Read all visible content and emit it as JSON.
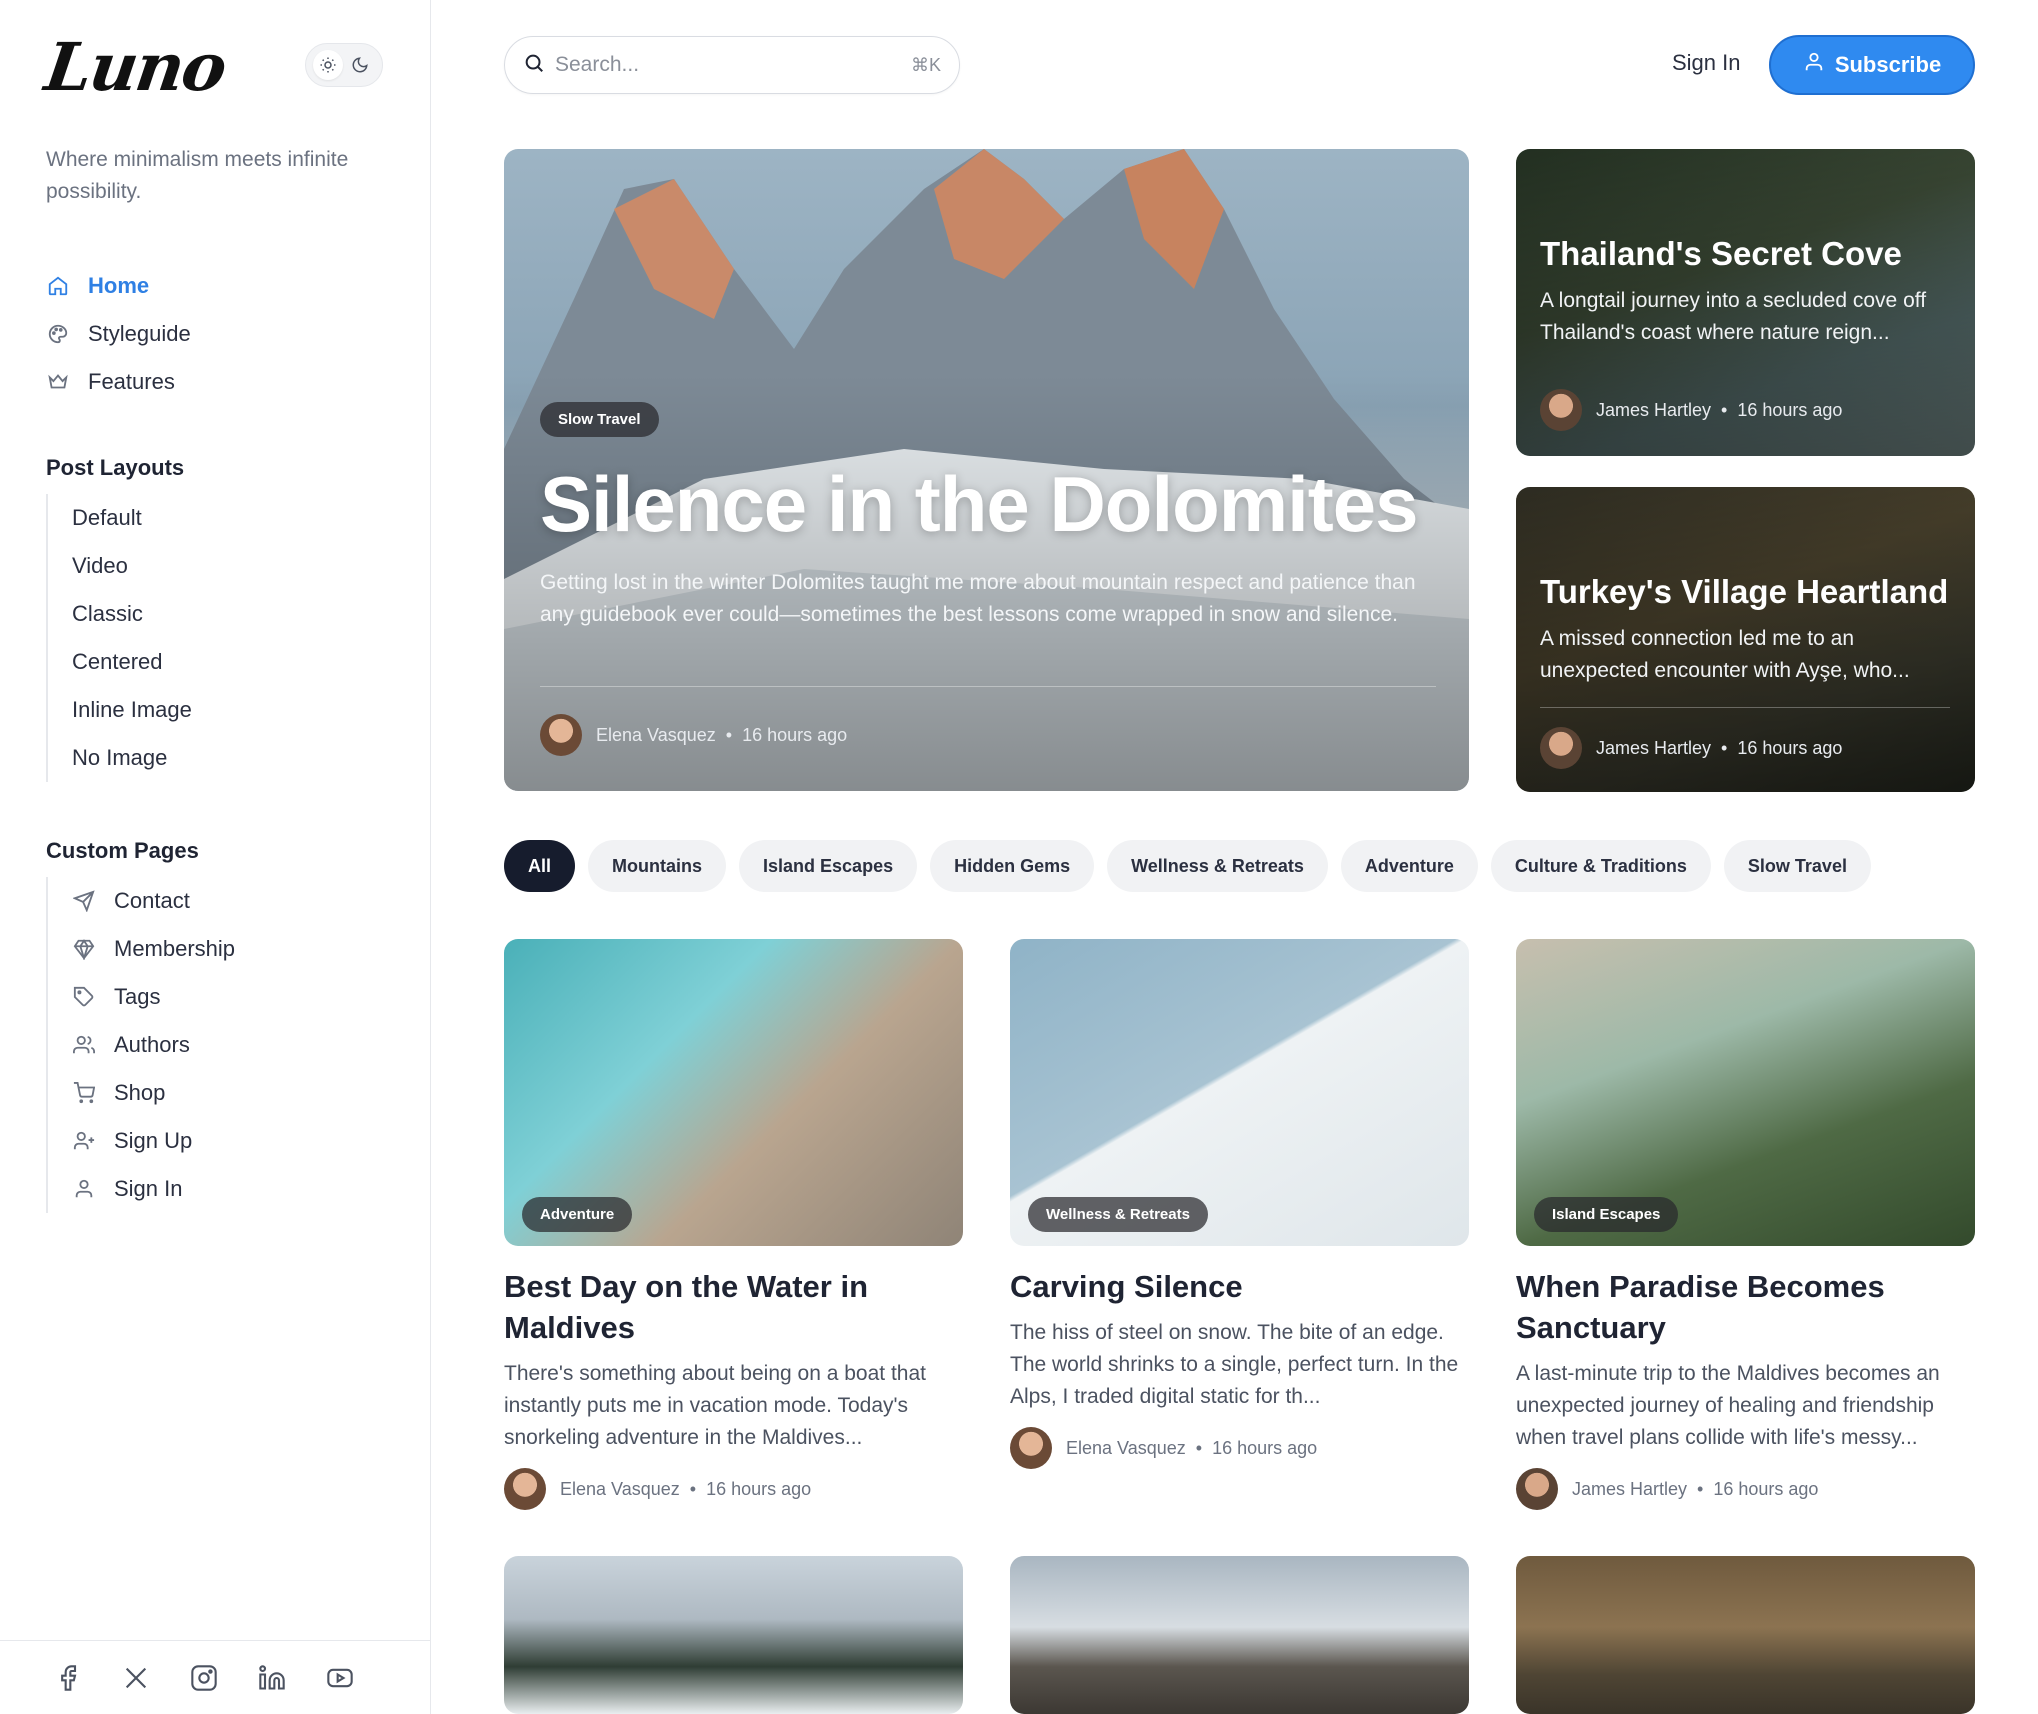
{
  "brand": {
    "logo": "Luno",
    "tagline": "Where minimalism meets infinite possibility."
  },
  "theme_toggle": {
    "light_icon": "sun-icon",
    "dark_icon": "moon-icon"
  },
  "nav": [
    {
      "label": "Home",
      "icon": "home-icon",
      "active": true
    },
    {
      "label": "Styleguide",
      "icon": "palette-icon"
    },
    {
      "label": "Features",
      "icon": "crown-icon"
    }
  ],
  "post_layouts": {
    "title": "Post Layouts",
    "items": [
      "Default",
      "Video",
      "Classic",
      "Centered",
      "Inline Image",
      "No Image"
    ]
  },
  "custom_pages": {
    "title": "Custom Pages",
    "items": [
      {
        "label": "Contact",
        "icon": "send-icon"
      },
      {
        "label": "Membership",
        "icon": "diamond-icon"
      },
      {
        "label": "Tags",
        "icon": "tag-icon"
      },
      {
        "label": "Authors",
        "icon": "users-icon"
      },
      {
        "label": "Shop",
        "icon": "cart-icon"
      },
      {
        "label": "Sign Up",
        "icon": "user-plus-icon"
      },
      {
        "label": "Sign In",
        "icon": "user-icon"
      }
    ]
  },
  "social": [
    "facebook-icon",
    "x-icon",
    "instagram-icon",
    "linkedin-icon",
    "youtube-icon"
  ],
  "header": {
    "search_placeholder": "Search...",
    "search_shortcut": "⌘K",
    "sign_in": "Sign In",
    "subscribe": "Subscribe"
  },
  "hero": {
    "tag": "Slow Travel",
    "title": "Silence in the Dolomites",
    "excerpt": "Getting lost in the winter Dolomites taught me more about mountain respect and patience than any guidebook ever could—sometimes the best lessons come wrapped in snow and silence.",
    "author": "Elena Vasquez",
    "time": "16 hours ago"
  },
  "side_posts": [
    {
      "title": "Thailand's Secret Cove",
      "excerpt": "A longtail journey into a secluded cove off Thailand's coast where nature reign...",
      "author": "James Hartley",
      "time": "16 hours ago"
    },
    {
      "title": "Turkey's Village Heartland",
      "excerpt": "A missed connection led me to an unexpected encounter with Ayşe, who...",
      "author": "James Hartley",
      "time": "16 hours ago"
    }
  ],
  "filters": [
    "All",
    "Mountains",
    "Island Escapes",
    "Hidden Gems",
    "Wellness & Retreats",
    "Adventure",
    "Culture & Traditions",
    "Slow Travel"
  ],
  "posts": [
    {
      "tag": "Adventure",
      "title": "Best Day on the Water in Maldives",
      "excerpt": "There's something about being on a boat that instantly puts me in vacation mode. Today's snorkeling adventure in the Maldives...",
      "author": "Elena Vasquez",
      "time": "16 hours ago"
    },
    {
      "tag": "Wellness & Retreats",
      "title": "Carving Silence",
      "excerpt": "The hiss of steel on snow. The bite of an edge. The world shrinks to a single, perfect turn. In the Alps, I traded digital static for th...",
      "author": "Elena Vasquez",
      "time": "16 hours ago"
    },
    {
      "tag": "Island Escapes",
      "title": "When Paradise Becomes Sanctuary",
      "excerpt": "A last-minute trip to the Maldives becomes an unexpected journey of healing and friendship when travel plans collide with life's messy...",
      "author": "James Hartley",
      "time": "16 hours ago"
    }
  ],
  "colors": {
    "accent": "#2f8af0",
    "active_nav": "#2f80e4",
    "pill_dark": "#161c2d"
  }
}
